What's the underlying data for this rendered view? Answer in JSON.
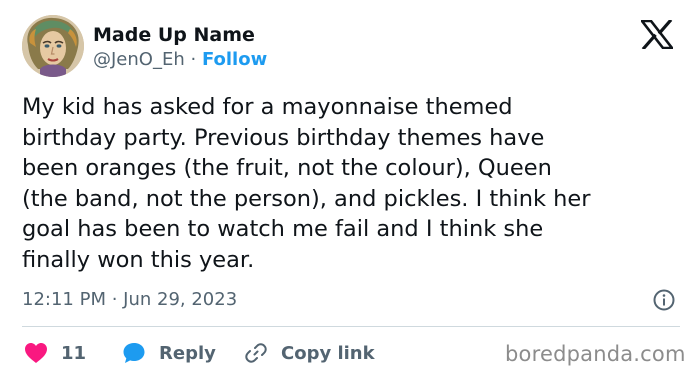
{
  "author": {
    "name": "Made Up Name",
    "handle": "@JenO_Eh",
    "separator": "·",
    "follow_label": "Follow"
  },
  "icons": {
    "avatar": "avatar-portrait",
    "brand": "x-logo-icon",
    "info": "info-icon",
    "like": "heart-icon",
    "reply": "speech-bubble-icon",
    "copy": "link-icon"
  },
  "tweet": {
    "lines": [
      "My kid has asked for a mayonnaise themed",
      "birthday party. Previous birthday themes have",
      "been oranges (the fruit, not the colour), Queen",
      "(the band, not the person), and pickles. I think her",
      "goal has been to watch me fail and I think she",
      "finally won this year."
    ],
    "timestamp": "12:11 PM · Jun 29, 2023"
  },
  "actions": {
    "like_count": "11",
    "reply_label": "Reply",
    "copy_label": "Copy link"
  },
  "colors": {
    "text": "#0f1419",
    "secondary": "#536471",
    "link": "#1d9bf0",
    "heart": "#f91880",
    "divider": "#cfd9de",
    "watermark": "#8c8c8c"
  },
  "watermark": "boredpanda.com"
}
